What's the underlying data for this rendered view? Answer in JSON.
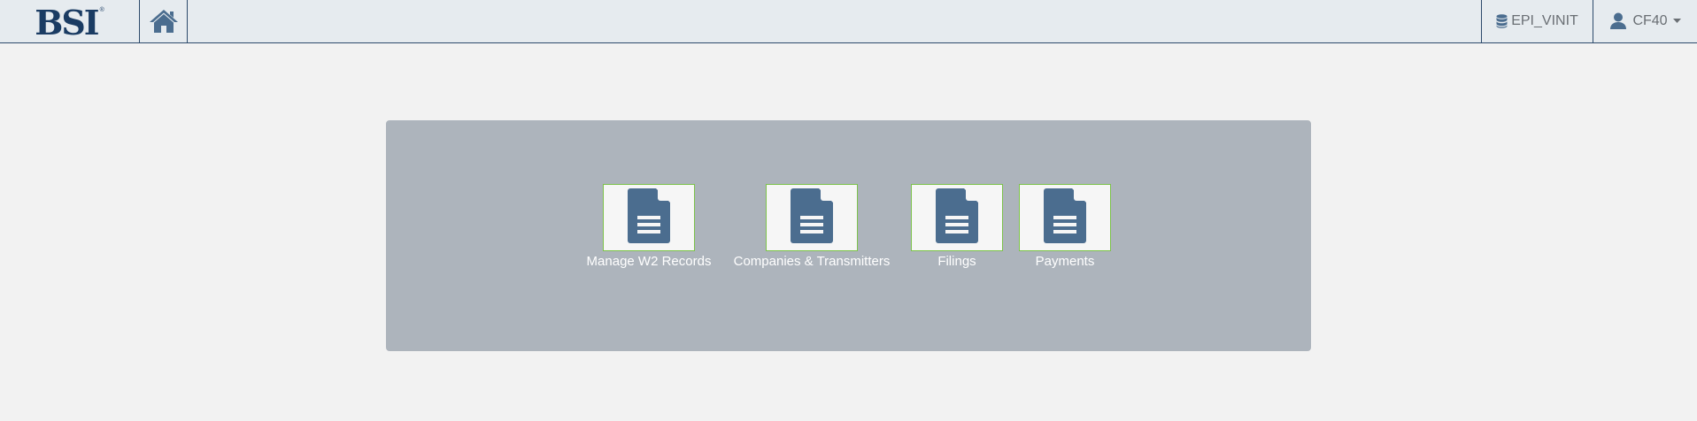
{
  "header": {
    "logo_text": "BSI",
    "logo_mark": "®",
    "home_icon": "home-icon",
    "database": {
      "icon": "database-icon",
      "label": "EPI_VINIT"
    },
    "user": {
      "icon": "user-icon",
      "label": "CF40",
      "caret_icon": "caret-down-icon"
    }
  },
  "tiles": [
    {
      "label": "Manage W2 Records",
      "icon": "document-icon"
    },
    {
      "label": "Companies & Transmitters",
      "icon": "document-icon"
    },
    {
      "label": "Filings",
      "icon": "document-icon"
    },
    {
      "label": "Payments",
      "icon": "document-icon"
    }
  ],
  "colors": {
    "topbar_bg": "#e6ebef",
    "brand_navy": "#1b3c63",
    "icon_blue": "#4b6d8f",
    "panel_bg": "#adb4bc",
    "tile_border": "#7cc24a",
    "page_bg": "#f2f2f2"
  }
}
